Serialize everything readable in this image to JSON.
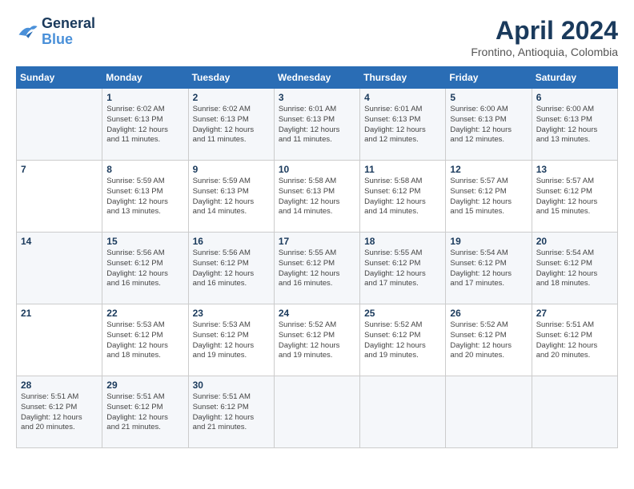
{
  "logo": {
    "line1": "General",
    "line2": "Blue"
  },
  "title": "April 2024",
  "location": "Frontino, Antioquia, Colombia",
  "weekdays": [
    "Sunday",
    "Monday",
    "Tuesday",
    "Wednesday",
    "Thursday",
    "Friday",
    "Saturday"
  ],
  "weeks": [
    [
      {
        "day": "",
        "info": ""
      },
      {
        "day": "1",
        "info": "Sunrise: 6:02 AM\nSunset: 6:13 PM\nDaylight: 12 hours\nand 11 minutes."
      },
      {
        "day": "2",
        "info": "Sunrise: 6:02 AM\nSunset: 6:13 PM\nDaylight: 12 hours\nand 11 minutes."
      },
      {
        "day": "3",
        "info": "Sunrise: 6:01 AM\nSunset: 6:13 PM\nDaylight: 12 hours\nand 11 minutes."
      },
      {
        "day": "4",
        "info": "Sunrise: 6:01 AM\nSunset: 6:13 PM\nDaylight: 12 hours\nand 12 minutes."
      },
      {
        "day": "5",
        "info": "Sunrise: 6:00 AM\nSunset: 6:13 PM\nDaylight: 12 hours\nand 12 minutes."
      },
      {
        "day": "6",
        "info": "Sunrise: 6:00 AM\nSunset: 6:13 PM\nDaylight: 12 hours\nand 13 minutes."
      }
    ],
    [
      {
        "day": "7",
        "info": ""
      },
      {
        "day": "8",
        "info": "Sunrise: 5:59 AM\nSunset: 6:13 PM\nDaylight: 12 hours\nand 13 minutes."
      },
      {
        "day": "9",
        "info": "Sunrise: 5:59 AM\nSunset: 6:13 PM\nDaylight: 12 hours\nand 14 minutes."
      },
      {
        "day": "10",
        "info": "Sunrise: 5:58 AM\nSunset: 6:13 PM\nDaylight: 12 hours\nand 14 minutes."
      },
      {
        "day": "11",
        "info": "Sunrise: 5:58 AM\nSunset: 6:12 PM\nDaylight: 12 hours\nand 14 minutes."
      },
      {
        "day": "12",
        "info": "Sunrise: 5:57 AM\nSunset: 6:12 PM\nDaylight: 12 hours\nand 15 minutes."
      },
      {
        "day": "13",
        "info": "Sunrise: 5:57 AM\nSunset: 6:12 PM\nDaylight: 12 hours\nand 15 minutes."
      }
    ],
    [
      {
        "day": "14",
        "info": ""
      },
      {
        "day": "15",
        "info": "Sunrise: 5:56 AM\nSunset: 6:12 PM\nDaylight: 12 hours\nand 16 minutes."
      },
      {
        "day": "16",
        "info": "Sunrise: 5:56 AM\nSunset: 6:12 PM\nDaylight: 12 hours\nand 16 minutes."
      },
      {
        "day": "17",
        "info": "Sunrise: 5:55 AM\nSunset: 6:12 PM\nDaylight: 12 hours\nand 16 minutes."
      },
      {
        "day": "18",
        "info": "Sunrise: 5:55 AM\nSunset: 6:12 PM\nDaylight: 12 hours\nand 17 minutes."
      },
      {
        "day": "19",
        "info": "Sunrise: 5:54 AM\nSunset: 6:12 PM\nDaylight: 12 hours\nand 17 minutes."
      },
      {
        "day": "20",
        "info": "Sunrise: 5:54 AM\nSunset: 6:12 PM\nDaylight: 12 hours\nand 18 minutes."
      }
    ],
    [
      {
        "day": "21",
        "info": ""
      },
      {
        "day": "22",
        "info": "Sunrise: 5:53 AM\nSunset: 6:12 PM\nDaylight: 12 hours\nand 18 minutes."
      },
      {
        "day": "23",
        "info": "Sunrise: 5:53 AM\nSunset: 6:12 PM\nDaylight: 12 hours\nand 19 minutes."
      },
      {
        "day": "24",
        "info": "Sunrise: 5:52 AM\nSunset: 6:12 PM\nDaylight: 12 hours\nand 19 minutes."
      },
      {
        "day": "25",
        "info": "Sunrise: 5:52 AM\nSunset: 6:12 PM\nDaylight: 12 hours\nand 19 minutes."
      },
      {
        "day": "26",
        "info": "Sunrise: 5:52 AM\nSunset: 6:12 PM\nDaylight: 12 hours\nand 20 minutes."
      },
      {
        "day": "27",
        "info": "Sunrise: 5:51 AM\nSunset: 6:12 PM\nDaylight: 12 hours\nand 20 minutes."
      }
    ],
    [
      {
        "day": "28",
        "info": "Sunrise: 5:51 AM\nSunset: 6:12 PM\nDaylight: 12 hours\nand 20 minutes."
      },
      {
        "day": "29",
        "info": "Sunrise: 5:51 AM\nSunset: 6:12 PM\nDaylight: 12 hours\nand 21 minutes."
      },
      {
        "day": "30",
        "info": "Sunrise: 5:51 AM\nSunset: 6:12 PM\nDaylight: 12 hours\nand 21 minutes."
      },
      {
        "day": "",
        "info": ""
      },
      {
        "day": "",
        "info": ""
      },
      {
        "day": "",
        "info": ""
      },
      {
        "day": "",
        "info": ""
      }
    ]
  ]
}
